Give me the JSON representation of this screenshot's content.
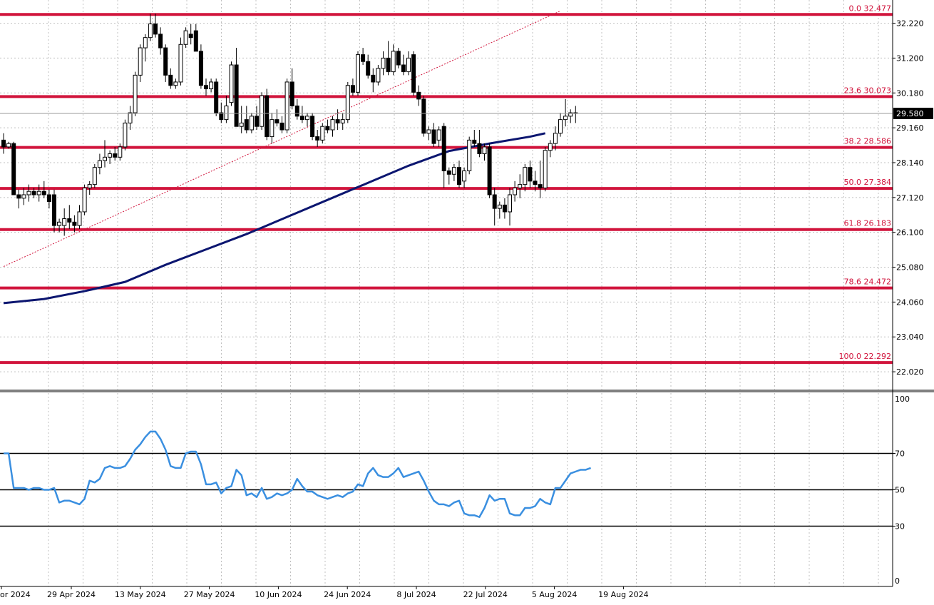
{
  "chart_data": [
    {
      "type": "candlestick",
      "price_axis": {
        "ticks": [
          "32.220",
          "31.200",
          "30.180",
          "29.160",
          "28.140",
          "27.120",
          "26.100",
          "25.080",
          "24.060",
          "23.040",
          "22.020"
        ],
        "ylim": [
          21.5,
          32.9
        ]
      },
      "current_price": "29.580",
      "current_price_value": 29.58,
      "fib_levels": [
        {
          "label": "0.0 32.477",
          "value": 32.477
        },
        {
          "label": "23.6 30.073",
          "value": 30.073
        },
        {
          "label": "38.2 28.586",
          "value": 28.586
        },
        {
          "label": "50.0 27.384",
          "value": 27.384
        },
        {
          "label": "61.8 26.183",
          "value": 26.183
        },
        {
          "label": "78.6 24.472",
          "value": 24.472
        },
        {
          "label": "100.0 22.292",
          "value": 22.292
        }
      ],
      "trendline": {
        "from": {
          "bar": 0,
          "value": 25.1
        },
        "to": {
          "bar": 107,
          "value": 32.4
        }
      },
      "moving_average": [
        [
          0,
          24.03
        ],
        [
          8,
          24.15
        ],
        [
          16,
          24.38
        ],
        [
          24,
          24.65
        ],
        [
          32,
          25.15
        ],
        [
          40,
          25.6
        ],
        [
          48,
          26.05
        ],
        [
          56,
          26.55
        ],
        [
          64,
          27.05
        ],
        [
          72,
          27.55
        ],
        [
          80,
          28.05
        ],
        [
          88,
          28.48
        ],
        [
          96,
          28.7
        ],
        [
          104,
          28.9
        ],
        [
          107,
          29.0
        ]
      ],
      "candles": [
        [
          28.8,
          29.0,
          28.4,
          28.6
        ],
        [
          28.6,
          28.75,
          28.55,
          28.7
        ],
        [
          28.7,
          28.75,
          27.3,
          27.2
        ],
        [
          27.2,
          27.35,
          26.8,
          27.1
        ],
        [
          27.1,
          27.4,
          26.9,
          27.2
        ],
        [
          27.2,
          27.5,
          27.0,
          27.3
        ],
        [
          27.3,
          27.4,
          27.1,
          27.2
        ],
        [
          27.2,
          27.5,
          27.0,
          27.3
        ],
        [
          27.3,
          27.6,
          27.1,
          27.2
        ],
        [
          27.2,
          27.35,
          26.8,
          27.0
        ],
        [
          27.2,
          27.35,
          26.1,
          26.3
        ],
        [
          26.3,
          26.5,
          26.1,
          26.4
        ],
        [
          26.3,
          26.8,
          26.0,
          26.5
        ],
        [
          26.5,
          26.9,
          26.2,
          26.4
        ],
        [
          26.4,
          26.6,
          26.1,
          26.3
        ],
        [
          26.3,
          26.9,
          26.2,
          26.7
        ],
        [
          26.7,
          27.5,
          26.6,
          27.4
        ],
        [
          27.4,
          27.6,
          27.2,
          27.5
        ],
        [
          27.5,
          28.1,
          27.4,
          28.0
        ],
        [
          28.0,
          28.4,
          27.8,
          28.2
        ],
        [
          28.2,
          28.8,
          28.0,
          28.3
        ],
        [
          28.3,
          28.5,
          28.1,
          28.4
        ],
        [
          28.4,
          28.6,
          28.2,
          28.3
        ],
        [
          28.3,
          28.7,
          28.2,
          28.6
        ],
        [
          28.6,
          29.4,
          28.5,
          29.3
        ],
        [
          29.3,
          29.8,
          29.1,
          29.6
        ],
        [
          29.6,
          30.8,
          29.5,
          30.7
        ],
        [
          30.7,
          31.6,
          30.5,
          31.5
        ],
        [
          31.5,
          31.9,
          31.1,
          31.8
        ],
        [
          31.8,
          32.5,
          31.7,
          32.2
        ],
        [
          32.2,
          32.5,
          31.8,
          31.9
        ],
        [
          31.9,
          32.1,
          31.3,
          31.5
        ],
        [
          31.5,
          31.6,
          30.5,
          30.7
        ],
        [
          30.7,
          30.9,
          30.3,
          30.4
        ],
        [
          30.4,
          30.6,
          30.3,
          30.5
        ],
        [
          30.5,
          31.8,
          30.4,
          31.6
        ],
        [
          31.6,
          32.1,
          31.5,
          32.0
        ],
        [
          31.9,
          32.2,
          31.6,
          31.8
        ],
        [
          32.0,
          32.2,
          31.5,
          31.4
        ],
        [
          31.4,
          31.6,
          30.3,
          30.4
        ],
        [
          30.4,
          30.6,
          30.1,
          30.3
        ],
        [
          30.3,
          30.6,
          30.2,
          30.5
        ],
        [
          30.5,
          30.6,
          29.5,
          29.6
        ],
        [
          29.6,
          29.9,
          29.3,
          29.4
        ],
        [
          29.4,
          30.1,
          29.3,
          29.8
        ],
        [
          29.9,
          31.1,
          29.8,
          31.0
        ],
        [
          31.0,
          31.5,
          30.0,
          29.2
        ],
        [
          29.2,
          29.8,
          29.0,
          29.3
        ],
        [
          29.4,
          29.8,
          29.0,
          29.1
        ],
        [
          29.1,
          29.6,
          29.0,
          29.5
        ],
        [
          29.5,
          29.8,
          29.1,
          29.2
        ],
        [
          29.2,
          30.2,
          29.1,
          30.1
        ],
        [
          30.1,
          30.3,
          28.8,
          28.9
        ],
        [
          28.9,
          29.6,
          28.7,
          29.4
        ],
        [
          29.4,
          29.7,
          29.2,
          29.3
        ],
        [
          29.3,
          29.5,
          29.0,
          29.1
        ],
        [
          29.1,
          30.6,
          29.0,
          30.5
        ],
        [
          30.5,
          30.9,
          29.7,
          29.8
        ],
        [
          29.8,
          30.0,
          29.4,
          29.5
        ],
        [
          29.5,
          29.8,
          29.3,
          29.4
        ],
        [
          29.4,
          29.6,
          29.2,
          29.5
        ],
        [
          29.5,
          29.6,
          28.8,
          28.9
        ],
        [
          28.9,
          29.1,
          28.6,
          28.8
        ],
        [
          28.8,
          29.3,
          28.7,
          29.2
        ],
        [
          29.2,
          29.4,
          29.0,
          29.1
        ],
        [
          29.1,
          29.5,
          28.9,
          29.4
        ],
        [
          29.4,
          29.7,
          29.1,
          29.3
        ],
        [
          29.3,
          29.6,
          29.1,
          29.4
        ],
        [
          29.4,
          30.5,
          29.3,
          30.4
        ],
        [
          30.4,
          30.6,
          30.1,
          30.2
        ],
        [
          30.2,
          31.4,
          30.1,
          31.3
        ],
        [
          31.3,
          31.5,
          31.0,
          31.1
        ],
        [
          31.1,
          31.3,
          30.6,
          30.7
        ],
        [
          30.7,
          30.9,
          30.2,
          30.5
        ],
        [
          30.5,
          31.0,
          30.4,
          30.9
        ],
        [
          30.9,
          31.4,
          30.7,
          31.2
        ],
        [
          31.2,
          31.7,
          30.7,
          30.8
        ],
        [
          30.8,
          31.6,
          30.7,
          31.4
        ],
        [
          31.4,
          31.5,
          30.9,
          31.0
        ],
        [
          31.0,
          31.3,
          30.7,
          30.8
        ],
        [
          30.8,
          31.4,
          30.7,
          31.2
        ],
        [
          31.3,
          31.4,
          30.1,
          30.2
        ],
        [
          30.2,
          30.4,
          29.8,
          30.0
        ],
        [
          30.0,
          30.1,
          28.9,
          29.0
        ],
        [
          29.0,
          29.2,
          28.8,
          29.1
        ],
        [
          29.1,
          29.3,
          28.6,
          28.7
        ],
        [
          28.8,
          29.2,
          28.6,
          29.1
        ],
        [
          29.2,
          29.3,
          27.4,
          27.9
        ],
        [
          27.9,
          28.0,
          27.5,
          27.8
        ],
        [
          27.8,
          28.1,
          27.6,
          28.0
        ],
        [
          28.0,
          28.2,
          27.4,
          27.5
        ],
        [
          27.6,
          28.0,
          27.4,
          27.9
        ],
        [
          27.9,
          28.9,
          27.8,
          28.8
        ],
        [
          28.8,
          29.1,
          28.6,
          28.7
        ],
        [
          28.7,
          29.1,
          28.3,
          28.4
        ],
        [
          28.4,
          28.7,
          28.2,
          28.6
        ],
        [
          28.6,
          28.7,
          27.1,
          27.2
        ],
        [
          27.2,
          27.4,
          26.3,
          26.8
        ],
        [
          26.8,
          27.0,
          26.5,
          26.9
        ],
        [
          26.9,
          27.1,
          26.5,
          26.7
        ],
        [
          26.7,
          27.4,
          26.3,
          27.2
        ],
        [
          27.2,
          27.6,
          27.0,
          27.4
        ],
        [
          27.4,
          27.8,
          27.1,
          27.5
        ],
        [
          27.5,
          28.1,
          27.3,
          28.0
        ],
        [
          28.0,
          28.2,
          27.4,
          27.6
        ],
        [
          27.6,
          27.9,
          27.3,
          27.5
        ],
        [
          27.5,
          28.2,
          27.1,
          27.4
        ],
        [
          27.4,
          28.6,
          27.3,
          28.5
        ],
        [
          28.5,
          28.8,
          28.3,
          28.7
        ],
        [
          28.7,
          29.2,
          28.5,
          29.0
        ],
        [
          29.0,
          29.6,
          28.9,
          29.4
        ],
        [
          29.4,
          30.0,
          29.2,
          29.5
        ],
        [
          29.5,
          29.7,
          29.3,
          29.6
        ],
        [
          29.6,
          29.8,
          29.3,
          29.58
        ]
      ]
    },
    {
      "type": "line",
      "indicator": "oscillator",
      "ylim": [
        0,
        100
      ],
      "y_ticks": [
        "100",
        "0"
      ],
      "levels": [
        {
          "label": "70",
          "value": 70
        },
        {
          "label": "50",
          "value": 50
        },
        {
          "label": "30",
          "value": 30
        }
      ],
      "values": [
        70,
        70,
        51,
        51,
        51,
        50,
        51,
        51,
        50,
        50,
        51,
        43,
        44,
        44,
        43,
        42,
        45,
        55,
        54,
        56,
        62,
        63,
        62,
        62,
        63,
        67,
        72,
        75,
        79,
        82,
        82,
        78,
        72,
        63,
        62,
        62,
        70,
        71,
        71,
        64,
        53,
        53,
        54,
        48,
        51,
        52,
        61,
        58,
        47,
        48,
        46,
        51,
        45,
        46,
        48,
        47,
        48,
        50,
        56,
        52,
        49,
        49,
        47,
        46,
        45,
        46,
        47,
        46,
        48,
        49,
        53,
        52,
        59,
        62,
        58,
        57,
        57,
        59,
        62,
        57,
        58,
        59,
        60,
        55,
        49,
        44,
        42,
        42,
        41,
        43,
        44,
        37,
        36,
        36,
        35,
        40,
        47,
        44,
        45,
        45,
        37,
        36,
        36,
        40,
        40,
        41,
        45,
        43,
        42,
        51,
        51,
        55,
        59,
        60,
        61,
        61,
        62
      ]
    }
  ],
  "x_axis": {
    "labels": [
      "or 2024",
      "29 Apr 2024",
      "13 May 2024",
      "27 May 2024",
      "10 Jun 2024",
      "24 Jun 2024",
      "8 Jul 2024",
      "22 Jul 2024",
      "5 Aug 2024",
      "19 Aug 2024"
    ]
  },
  "colors": {
    "fib_line": "#d1143c",
    "moving_average": "#0c1670",
    "oscillator": "#3a8fe0",
    "trendline": "#d1143c",
    "grid": "#c0c0c0",
    "price_box": "#000000"
  }
}
